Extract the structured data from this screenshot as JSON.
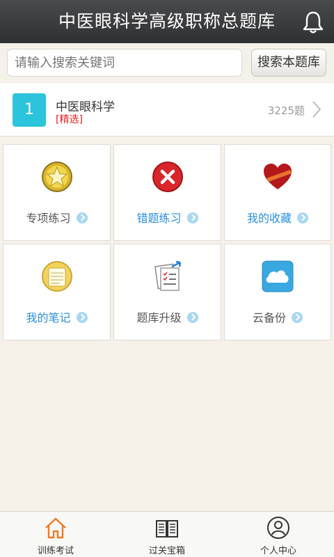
{
  "header": {
    "title": "中医眼科学高级职称总题库",
    "bell_icon": "bell-icon"
  },
  "search": {
    "placeholder": "请输入搜索关键词",
    "value": "",
    "button_label": "搜索本题库"
  },
  "subject": {
    "index": "1",
    "name": "中医眼科学",
    "tag": "[精选]",
    "count": "3225题"
  },
  "tiles": [
    {
      "label": "专项练习",
      "icon": "star-medal-icon",
      "color": "#555555"
    },
    {
      "label": "错题练习",
      "icon": "error-x-icon",
      "color": "#2b8fe0"
    },
    {
      "label": "我的收藏",
      "icon": "heart-favorite-icon",
      "color": "#2b8fe0"
    },
    {
      "label": "我的笔记",
      "icon": "notepad-icon",
      "color": "#2b8fe0"
    },
    {
      "label": "题库升级",
      "icon": "upgrade-document-icon",
      "color": "#555555"
    },
    {
      "label": "云备份",
      "icon": "cloud-backup-icon",
      "color": "#555555"
    }
  ],
  "tabbar": [
    {
      "label": "训练考试",
      "icon": "home-icon",
      "active": true
    },
    {
      "label": "过关宝箱",
      "icon": "book-icon",
      "active": false
    },
    {
      "label": "个人中心",
      "icon": "user-icon",
      "active": false
    }
  ],
  "colors": {
    "accent": "#2cc4db",
    "link_blue": "#2b8fe0",
    "tag_red": "#e02222",
    "active_tab": "#f07a22"
  }
}
